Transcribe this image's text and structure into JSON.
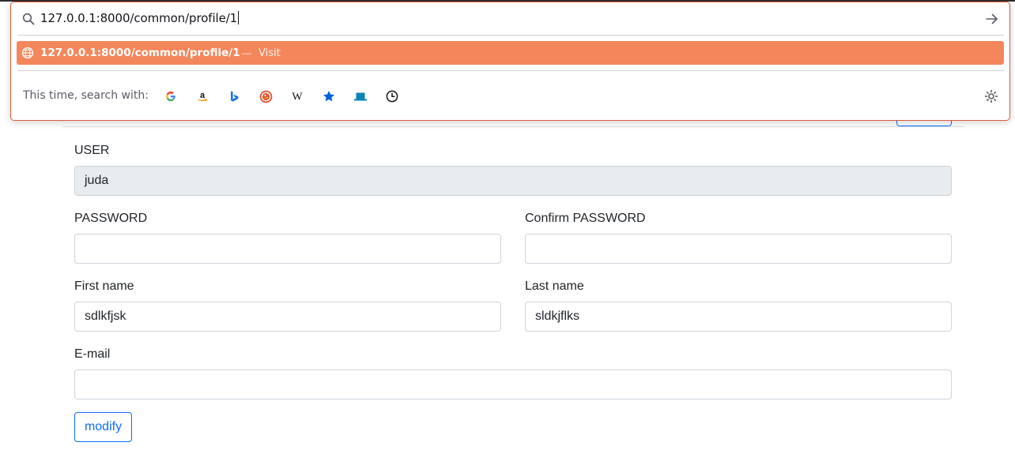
{
  "urlbar": {
    "input_value": "127.0.0.1:8000/common/profile/1",
    "suggestion": {
      "url": "127.0.0.1:8000/common/profile/1",
      "separator": "—",
      "action": "Visit"
    },
    "oneoffs": {
      "label": "This time, search with:",
      "engines": [
        {
          "name": "Google",
          "icon": "google-icon"
        },
        {
          "name": "Amazon",
          "icon": "amazon-icon"
        },
        {
          "name": "Bing",
          "icon": "bing-icon"
        },
        {
          "name": "DuckDuckGo",
          "icon": "duckduckgo-icon"
        },
        {
          "name": "Wikipedia",
          "icon": "wikipedia-icon"
        },
        {
          "name": "Bookmarks",
          "icon": "star-icon"
        },
        {
          "name": "Tabs",
          "icon": "tab-icon"
        },
        {
          "name": "History",
          "icon": "clock-icon"
        }
      ]
    },
    "accent_color": "#f3875b"
  },
  "form": {
    "user": {
      "label": "USER",
      "value": "juda"
    },
    "password": {
      "label": "PASSWORD",
      "value": ""
    },
    "confirm_password": {
      "label": "Confirm PASSWORD",
      "value": ""
    },
    "first_name": {
      "label": "First name",
      "value": "sdlkfjsk"
    },
    "last_name": {
      "label": "Last name",
      "value": "sldkjflks"
    },
    "email": {
      "label": "E-mail",
      "value": ""
    },
    "submit_label": "modify",
    "primary_color": "#0d6efd"
  }
}
